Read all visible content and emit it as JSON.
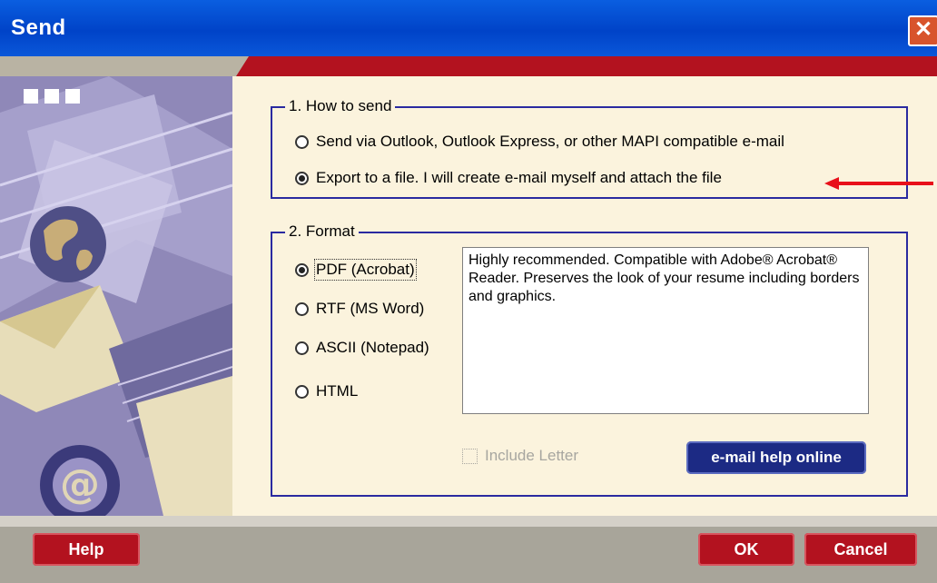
{
  "window": {
    "title": "Send",
    "close_glyph": "✕"
  },
  "how_to_send": {
    "legend": "1. How to send",
    "options": [
      {
        "label": "Send via Outlook, Outlook Express, or other MAPI compatible e-mail",
        "selected": false
      },
      {
        "label": "Export to a file. I will create e-mail myself and attach the file",
        "selected": true
      }
    ]
  },
  "format": {
    "legend": "2. Format",
    "options": [
      {
        "label": "PDF (Acrobat)",
        "selected": true
      },
      {
        "label": "RTF (MS Word)",
        "selected": false
      },
      {
        "label": "ASCII (Notepad)",
        "selected": false
      },
      {
        "label": "HTML",
        "selected": false
      }
    ],
    "description": "Highly recommended.  Compatible with Adobe® Acrobat® Reader.  Preserves the look of your resume including borders and graphics.",
    "include_letter": {
      "label": "Include Letter",
      "checked": false,
      "enabled": false
    },
    "help_online_label": "e-mail help online"
  },
  "footer": {
    "help_label": "Help",
    "ok_label": "OK",
    "cancel_label": "Cancel"
  },
  "colors": {
    "accent_red": "#b3121f",
    "frame_blue": "#2a2aa0",
    "panel_cream": "#fbf3dd",
    "annotation_arrow": "#e8101a"
  },
  "icons": [
    "close-icon",
    "globe-icon",
    "at-sign-icon",
    "envelope-icon",
    "arrow-annotation-icon"
  ]
}
